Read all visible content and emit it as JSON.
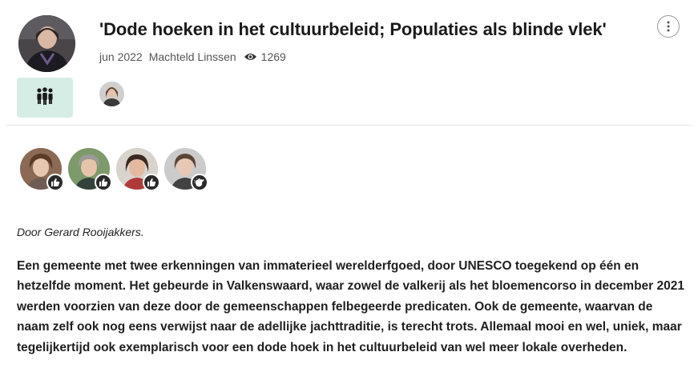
{
  "post": {
    "title": "'Dode hoeken in het cultuurbeleid; Populaties als blinde vlek'",
    "date": "jun 2022",
    "author": "Machteld Linssen",
    "views": "1269"
  },
  "icons": {
    "group": "people-group-icon",
    "views": "eye-icon",
    "more": "more-vertical-icon",
    "like": "thumbs-up-icon",
    "clap": "clap-hands-icon"
  },
  "reactions": [
    {
      "type": "like"
    },
    {
      "type": "like"
    },
    {
      "type": "like"
    },
    {
      "type": "clap"
    }
  ],
  "article": {
    "byline": "Door Gerard Rooijakkers.",
    "paragraph": "Een gemeente met twee erkenningen van immaterieel werelderfgoed, door UNESCO toegekend op één en hetzelfde moment. Het gebeurde in Valkenswaard, waar zowel de valkerij als het bloemencorso in december 2021 werden voorzien van deze door de gemeenschappen felbegeerde predicaten. Ook de gemeente, waarvan de naam zelf ook nog eens verwijst naar de adellijke jachttraditie, is terecht trots. Allemaal mooi en wel, uniek, maar tegelijkertijd ook exemplarisch voor een dode hoek in het cultuurbeleid van wel meer lokale overheden."
  },
  "colors": {
    "group_tile": "#d6ede6",
    "badge": "#2a2a2a"
  }
}
